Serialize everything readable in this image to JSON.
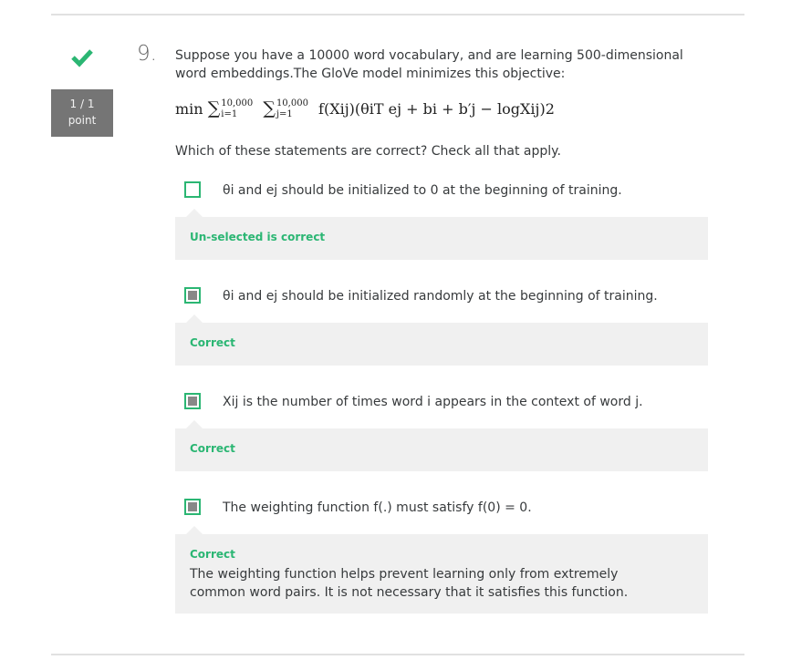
{
  "question": {
    "number": "9.",
    "score": {
      "line1": "1 / 1",
      "line2": "point"
    },
    "text": "Suppose you have a 10000 word vocabulary, and are learning 500-dimensional word embeddings.The GloVe model minimizes this objective:",
    "formula": {
      "min": "min",
      "sum_upper": "10,000",
      "sum1_lower": "i=1",
      "sum2_lower": "j=1",
      "body": "f(Xij)(θiT ej + bi + b′j − logXij)2"
    },
    "instruction": "Which of these statements are correct? Check all that apply."
  },
  "options": [
    {
      "checked": false,
      "text": "θi and ej should be initialized to 0 at the beginning of training.",
      "feedback_status": "Un-selected is correct",
      "feedback_explanation": ""
    },
    {
      "checked": true,
      "text": "θi and ej should be initialized randomly at the beginning of training.",
      "feedback_status": "Correct",
      "feedback_explanation": ""
    },
    {
      "checked": true,
      "text": "Xij is the number of times word i appears in the context of word j.",
      "feedback_status": "Correct",
      "feedback_explanation": ""
    },
    {
      "checked": true,
      "text": "The weighting function f(.) must satisfy f(0) = 0.",
      "feedback_status": "Correct",
      "feedback_explanation": "The weighting function helps prevent learning only from extremely common word pairs. It is not necessary that it satisfies this function."
    }
  ],
  "colors": {
    "correct": "#2bb673",
    "score_bg": "#757575",
    "feedback_bg": "#f0f0f0"
  },
  "icons": {
    "status": "checkmark-icon"
  }
}
